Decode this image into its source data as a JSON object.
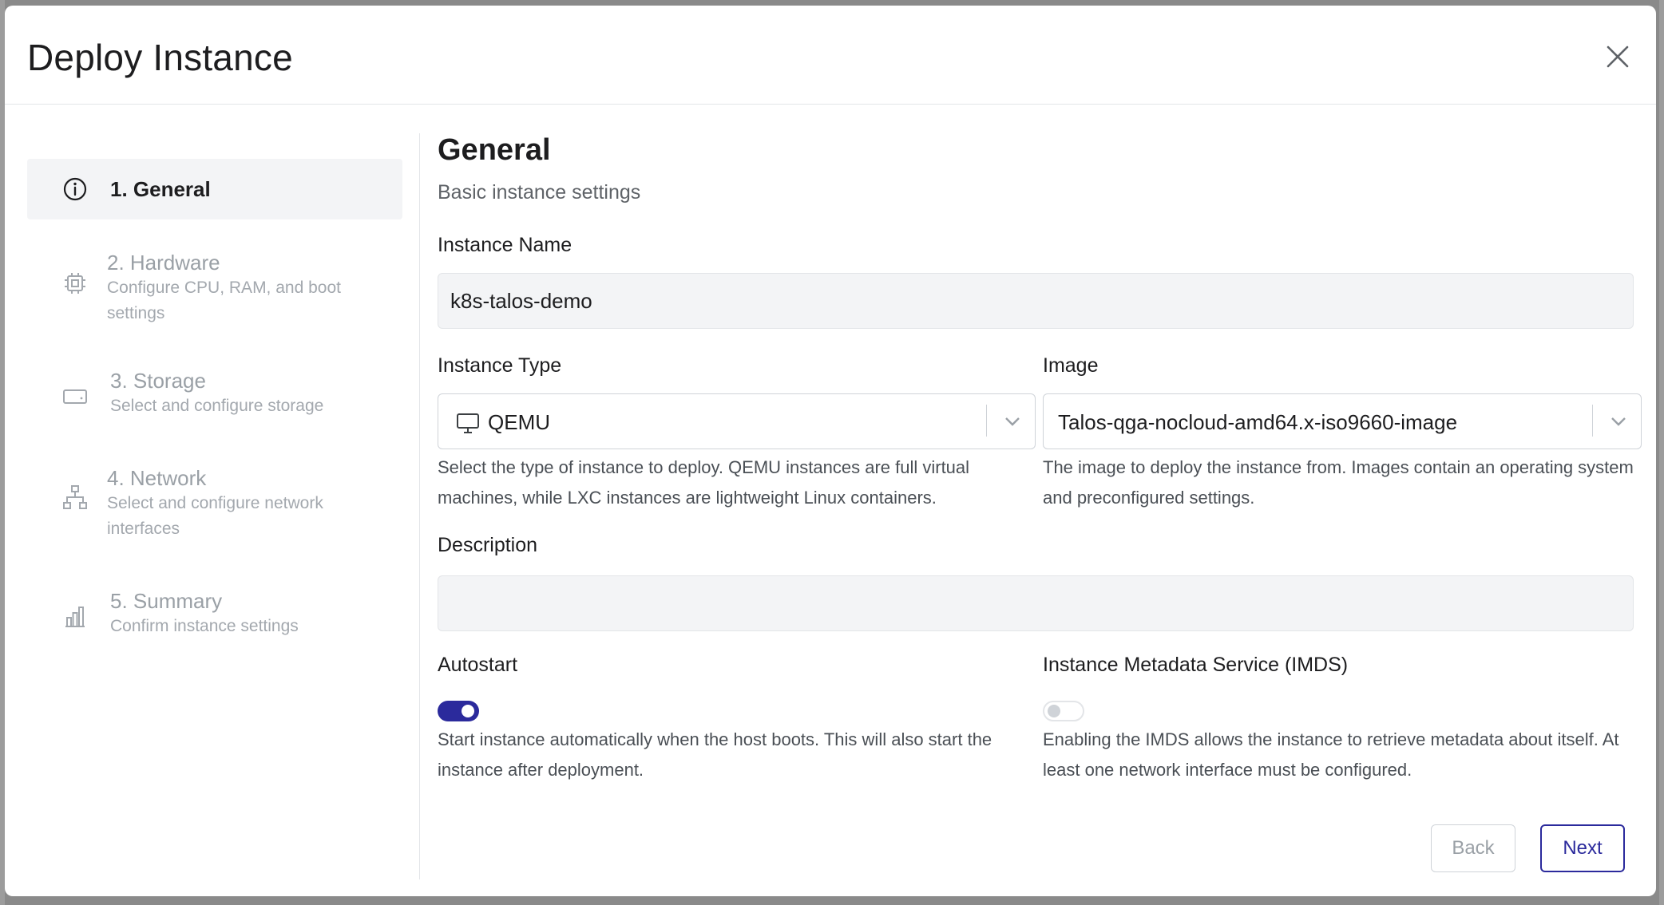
{
  "modal": {
    "title": "Deploy Instance",
    "close_icon": "close-icon"
  },
  "steps": [
    {
      "title": "1. General",
      "description": "",
      "icon": "info-icon",
      "active": true
    },
    {
      "title": "2. Hardware",
      "description": "Configure CPU, RAM, and boot settings",
      "icon": "chip-icon",
      "active": false
    },
    {
      "title": "3. Storage",
      "description": "Select and configure storage",
      "icon": "drive-icon",
      "active": false
    },
    {
      "title": "4. Network",
      "description": "Select and configure network interfaces",
      "icon": "network-icon",
      "active": false
    },
    {
      "title": "5. Summary",
      "description": "Confirm instance settings",
      "icon": "bar-chart-icon",
      "active": false
    }
  ],
  "section": {
    "title": "General",
    "subtitle": "Basic instance settings"
  },
  "fields": {
    "instance_name": {
      "label": "Instance Name",
      "value": "k8s-talos-demo"
    },
    "instance_type": {
      "label": "Instance Type",
      "value": "QEMU",
      "icon": "monitor-icon",
      "help": "Select the type of instance to deploy. QEMU instances are full virtual machines, while LXC instances are lightweight Linux containers."
    },
    "image": {
      "label": "Image",
      "value": "Talos-qga-nocloud-amd64.x-iso9660-image",
      "help": "The image to deploy the instance from. Images contain an operating system and preconfigured settings."
    },
    "description": {
      "label": "Description",
      "value": ""
    },
    "autostart": {
      "label": "Autostart",
      "enabled": true,
      "help": "Start instance automatically when the host boots. This will also start the instance after deployment."
    },
    "imds": {
      "label": "Instance Metadata Service (IMDS)",
      "enabled": false,
      "help": "Enabling the IMDS allows the instance to retrieve metadata about itself. At least one network interface must be configured."
    }
  },
  "footer": {
    "back_label": "Back",
    "next_label": "Next"
  },
  "colors": {
    "accent": "#2b2a9c",
    "muted_text": "#9aa0a6",
    "input_bg": "#f3f4f6"
  }
}
